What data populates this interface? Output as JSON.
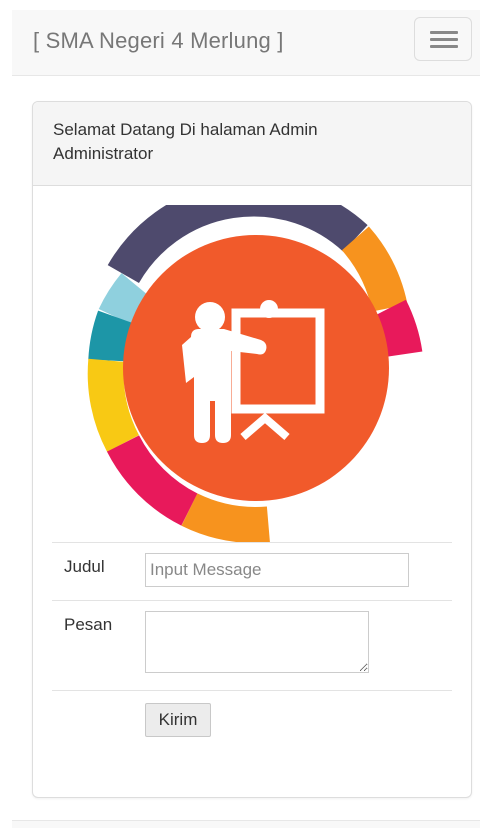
{
  "navbar": {
    "brand": "[ SMA Negeri 4 Merlung ]",
    "menu_icon": "hamburger-menu-icon"
  },
  "panel": {
    "heading_line1": "Selamat Datang Di halaman Admin",
    "heading_line2": "Administrator"
  },
  "logo": {
    "icon": "teacher-presentation-icon",
    "colors": {
      "center": "#f15a2b",
      "navy": "#4e4a6d",
      "orange": "#f7931e",
      "pink": "#e8195b",
      "light_blue": "#8fd0de",
      "teal": "#1d96a7",
      "yellow": "#f8c914"
    }
  },
  "form": {
    "judul_label": "Judul",
    "judul_placeholder": "Input Message",
    "pesan_label": "Pesan",
    "submit_label": "Kirim"
  }
}
